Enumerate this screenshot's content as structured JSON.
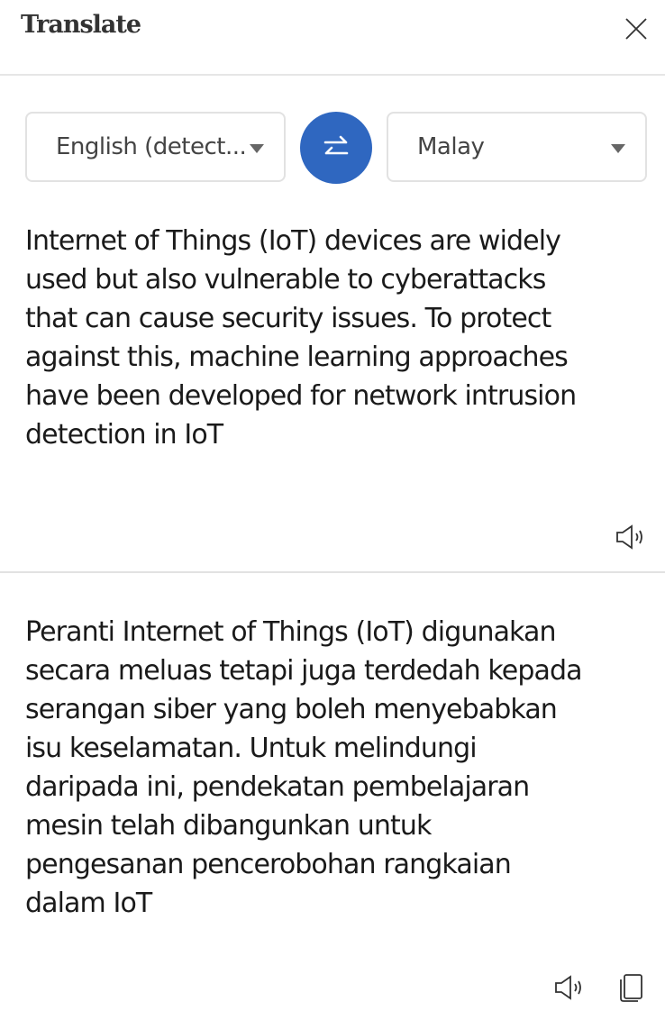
{
  "header": {
    "title": "Translate"
  },
  "languages": {
    "source": "English (detect...",
    "target": "Malay"
  },
  "source_text": {
    "lines": [
      "Internet of Things (IoT) devices are widely",
      "used but also vulnerable to cyberattacks",
      "that can cause security issues. To protect",
      "against this, machine learning approaches",
      "have been developed for network intrusion",
      "detection in IoT"
    ]
  },
  "translated_text": {
    "lines": [
      "Peranti Internet of Things (IoT) digunakan",
      "secara meluas tetapi juga terdedah kepada",
      "serangan siber yang boleh menyebabkan",
      "isu keselamatan. Untuk melindungi",
      "daripada ini, pendekatan pembelajaran",
      "mesin telah dibangunkan untuk",
      "pengesanan pencerobohan rangkaian",
      "dalam IoT"
    ]
  },
  "colors": {
    "accent": "#2f67c0"
  }
}
